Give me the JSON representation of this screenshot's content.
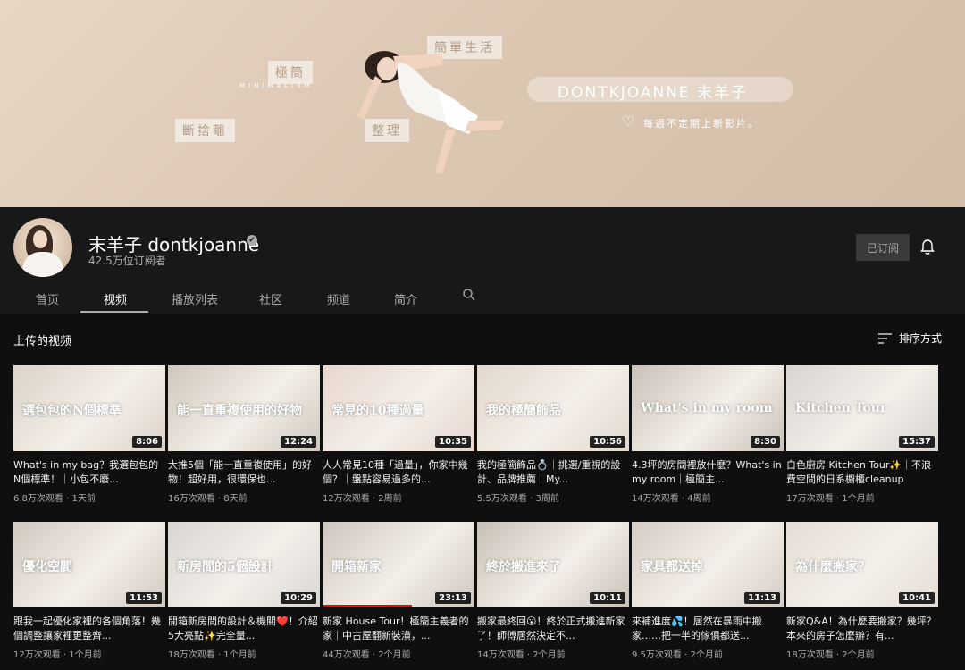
{
  "banner": {
    "tags": [
      "簡單生活",
      "極簡",
      "斷捨離",
      "整理"
    ],
    "minimalism": "MINIMALISM",
    "brand": "DONTKJOANNE 末羊子",
    "slogan": "每週不定期上新影片。"
  },
  "channel": {
    "name": "末羊子 dontkjoanne",
    "verified_icon": "✔",
    "subscribers": "42.5万位订阅者",
    "subscribed_label": "已订阅",
    "bell_icon": "bell-icon"
  },
  "tabs": [
    "首页",
    "视频",
    "播放列表",
    "社区",
    "频道",
    "简介"
  ],
  "active_tab": "视频",
  "section": {
    "title": "上传的视频",
    "sort_label": "排序方式"
  },
  "videos": [
    {
      "title": "What's in my bag？我選包包的N個標準！｜小包不廢...",
      "views": "6.8万次观看",
      "time": "1天前",
      "duration": "8:06",
      "overlay": "選包包的N個標準",
      "color": "#dcd3c8"
    },
    {
      "title": "大推5個「能一直重複使用」的好物！超好用，很環保也...",
      "views": "16万次观看",
      "time": "8天前",
      "duration": "12:24",
      "overlay": "能一直重複使用的好物",
      "color": "#cfc7bc"
    },
    {
      "title": "人人常見10種「過量」，你家中幾個？｜盤點容易過多的...",
      "views": "12万次观看",
      "time": "2周前",
      "duration": "10:35",
      "overlay": "常見的10種過量",
      "color": "#e7d6cd"
    },
    {
      "title": "我的極簡飾品💍｜挑選/重視的設計、品牌推薦｜My...",
      "views": "5.5万次观看",
      "time": "3周前",
      "duration": "10:56",
      "overlay": "我的極簡飾品",
      "color": "#e2d8cd"
    },
    {
      "title": "4.3坪的房間裡放什麼？What's in my room｜極簡主...",
      "views": "14万次观看",
      "time": "4周前",
      "duration": "8:30",
      "overlay": "What's in my room",
      "color": "#c9c1b8"
    },
    {
      "title": "白色廚房 Kitchen Tour✨｜不浪費空間的日系櫥櫃cleanup",
      "views": "17万次观看",
      "time": "1个月前",
      "duration": "15:37",
      "overlay": "Kitchen Tour",
      "color": "#d8d4cf"
    },
    {
      "title": "跟我一起優化家裡的各個角落！幾個調整讓家裡更整齊...",
      "views": "12万次观看",
      "time": "1个月前",
      "duration": "11:53",
      "overlay": "優化空間",
      "color": "#d2c9c0"
    },
    {
      "title": "開箱新房間的設計＆機關❤️！介紹5大亮點✨完全量...",
      "views": "18万次观看",
      "time": "1个月前",
      "duration": "10:29",
      "overlay": "新房間的5個設計",
      "color": "#d9d5d0"
    },
    {
      "title": "新家 House Tour！極簡主義者的家｜中古屋翻新裝潢，...",
      "views": "44万次观看",
      "time": "2个月前",
      "duration": "23:13",
      "overlay": "開箱新家",
      "color": "#cdc6be"
    },
    {
      "title": "搬家最終回😮！終於正式搬進新家了！師傅居然決定不...",
      "views": "14万次观看",
      "time": "2个月前",
      "duration": "10:11",
      "overlay": "終於搬進來了",
      "color": "#c8c0b6"
    },
    {
      "title": "來補進度💦！居然在暴雨中搬家……把一半的傢俱都送...",
      "views": "9.5万次观看",
      "time": "2个月前",
      "duration": "11:13",
      "overlay": "家具都送掉",
      "color": "#d5cdc4"
    },
    {
      "title": "新家Q&A！為什麼要搬家？幾坪？本來的房子怎麼辦？有...",
      "views": "18万次观看",
      "time": "2个月前",
      "duration": "10:41",
      "overlay": "為什麼搬家？",
      "color": "#e4ddd6"
    }
  ],
  "colors": {
    "background": "#0f0f0f",
    "header": "#181818",
    "progress": "#ff0000"
  }
}
